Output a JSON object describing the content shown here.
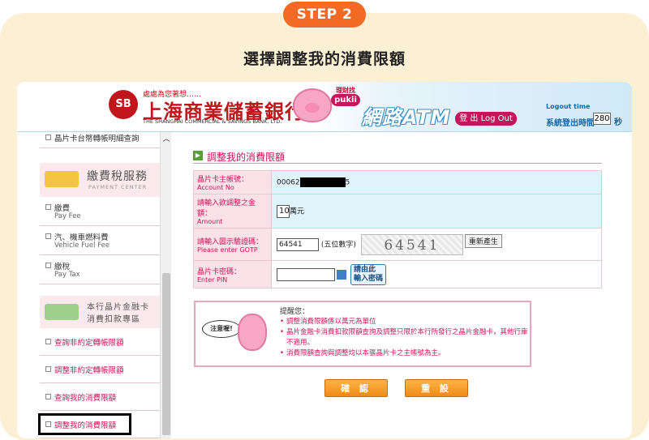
{
  "step": "STEP 2",
  "step_title": "選擇調整我的消費限額",
  "header": {
    "logo_text": "SB",
    "bank_sub": "處處為您著想……",
    "bank_name": "上海商業儲蓄銀行",
    "bank_en": "THE SHANGHAI COMMERCIAL & SAVINGS BANK, LTD.",
    "pukii_sub": "理財找",
    "pukii": "pukii",
    "atm_title": "網路ATM",
    "logout_label": "登 出 Log Out",
    "logout_time_label": "Logout time",
    "timer_label": "系統登出時間",
    "timer_value": "280",
    "timer_unit": "秒"
  },
  "sidebar": {
    "top_item": "晶片卡台幣轉帳明細查詢",
    "section1": {
      "title": "繳費稅服務",
      "en": "PAYMENT CENTER"
    },
    "items1": [
      {
        "label": "繳費",
        "en": "Pay Fee"
      },
      {
        "label": "汽、機車燃料費",
        "en": "Vehicle Fuel Fee"
      },
      {
        "label": "繳稅",
        "en": "Pay Tax"
      }
    ],
    "section2": {
      "title_line1": "本行晶片金融卡",
      "title_line2": "消費扣款專區"
    },
    "items2": [
      {
        "label": "查詢非約定轉帳限額"
      },
      {
        "label": "調整非約定轉帳限額"
      },
      {
        "label": "查詢我的消費限額"
      },
      {
        "label": "調整我的消費限額"
      }
    ]
  },
  "main": {
    "page_title": "調整我的消費限額",
    "form": {
      "account_label": "晶片卡主帳號：",
      "account_label_en": "Account No",
      "account_prefix": "00062",
      "account_suffix": "5",
      "amount_label": "請輸入欲調整之金額：",
      "amount_label_en": "Amount",
      "amount_value": "10",
      "amount_unit": "萬元",
      "captcha_label": "請輸入圖示驗證碼：",
      "captcha_label_en": "Please enter GOTP",
      "captcha_value": "64541",
      "captcha_hint": "(五位數字)",
      "captcha_image_text": "64541",
      "regen_label": "重新產生",
      "pin_label": "晶片卡密碼：",
      "pin_label_en": "Enter PIN",
      "pin_button_line1": "請由此",
      "pin_button_line2": "輸入密碼"
    },
    "notice": {
      "bubble": "注意喔!",
      "title": "提醒您：",
      "items": [
        "調整消費限額係以萬元為單位",
        "晶片金融卡消費扣款限額查詢及調整只限於本行所發行之晶片金融卡，其他行庫不適用。",
        "消費限額查詢與調整均以本張晶片卡之主帳號為主。"
      ]
    },
    "confirm": "確 認",
    "reset": "重 設"
  }
}
